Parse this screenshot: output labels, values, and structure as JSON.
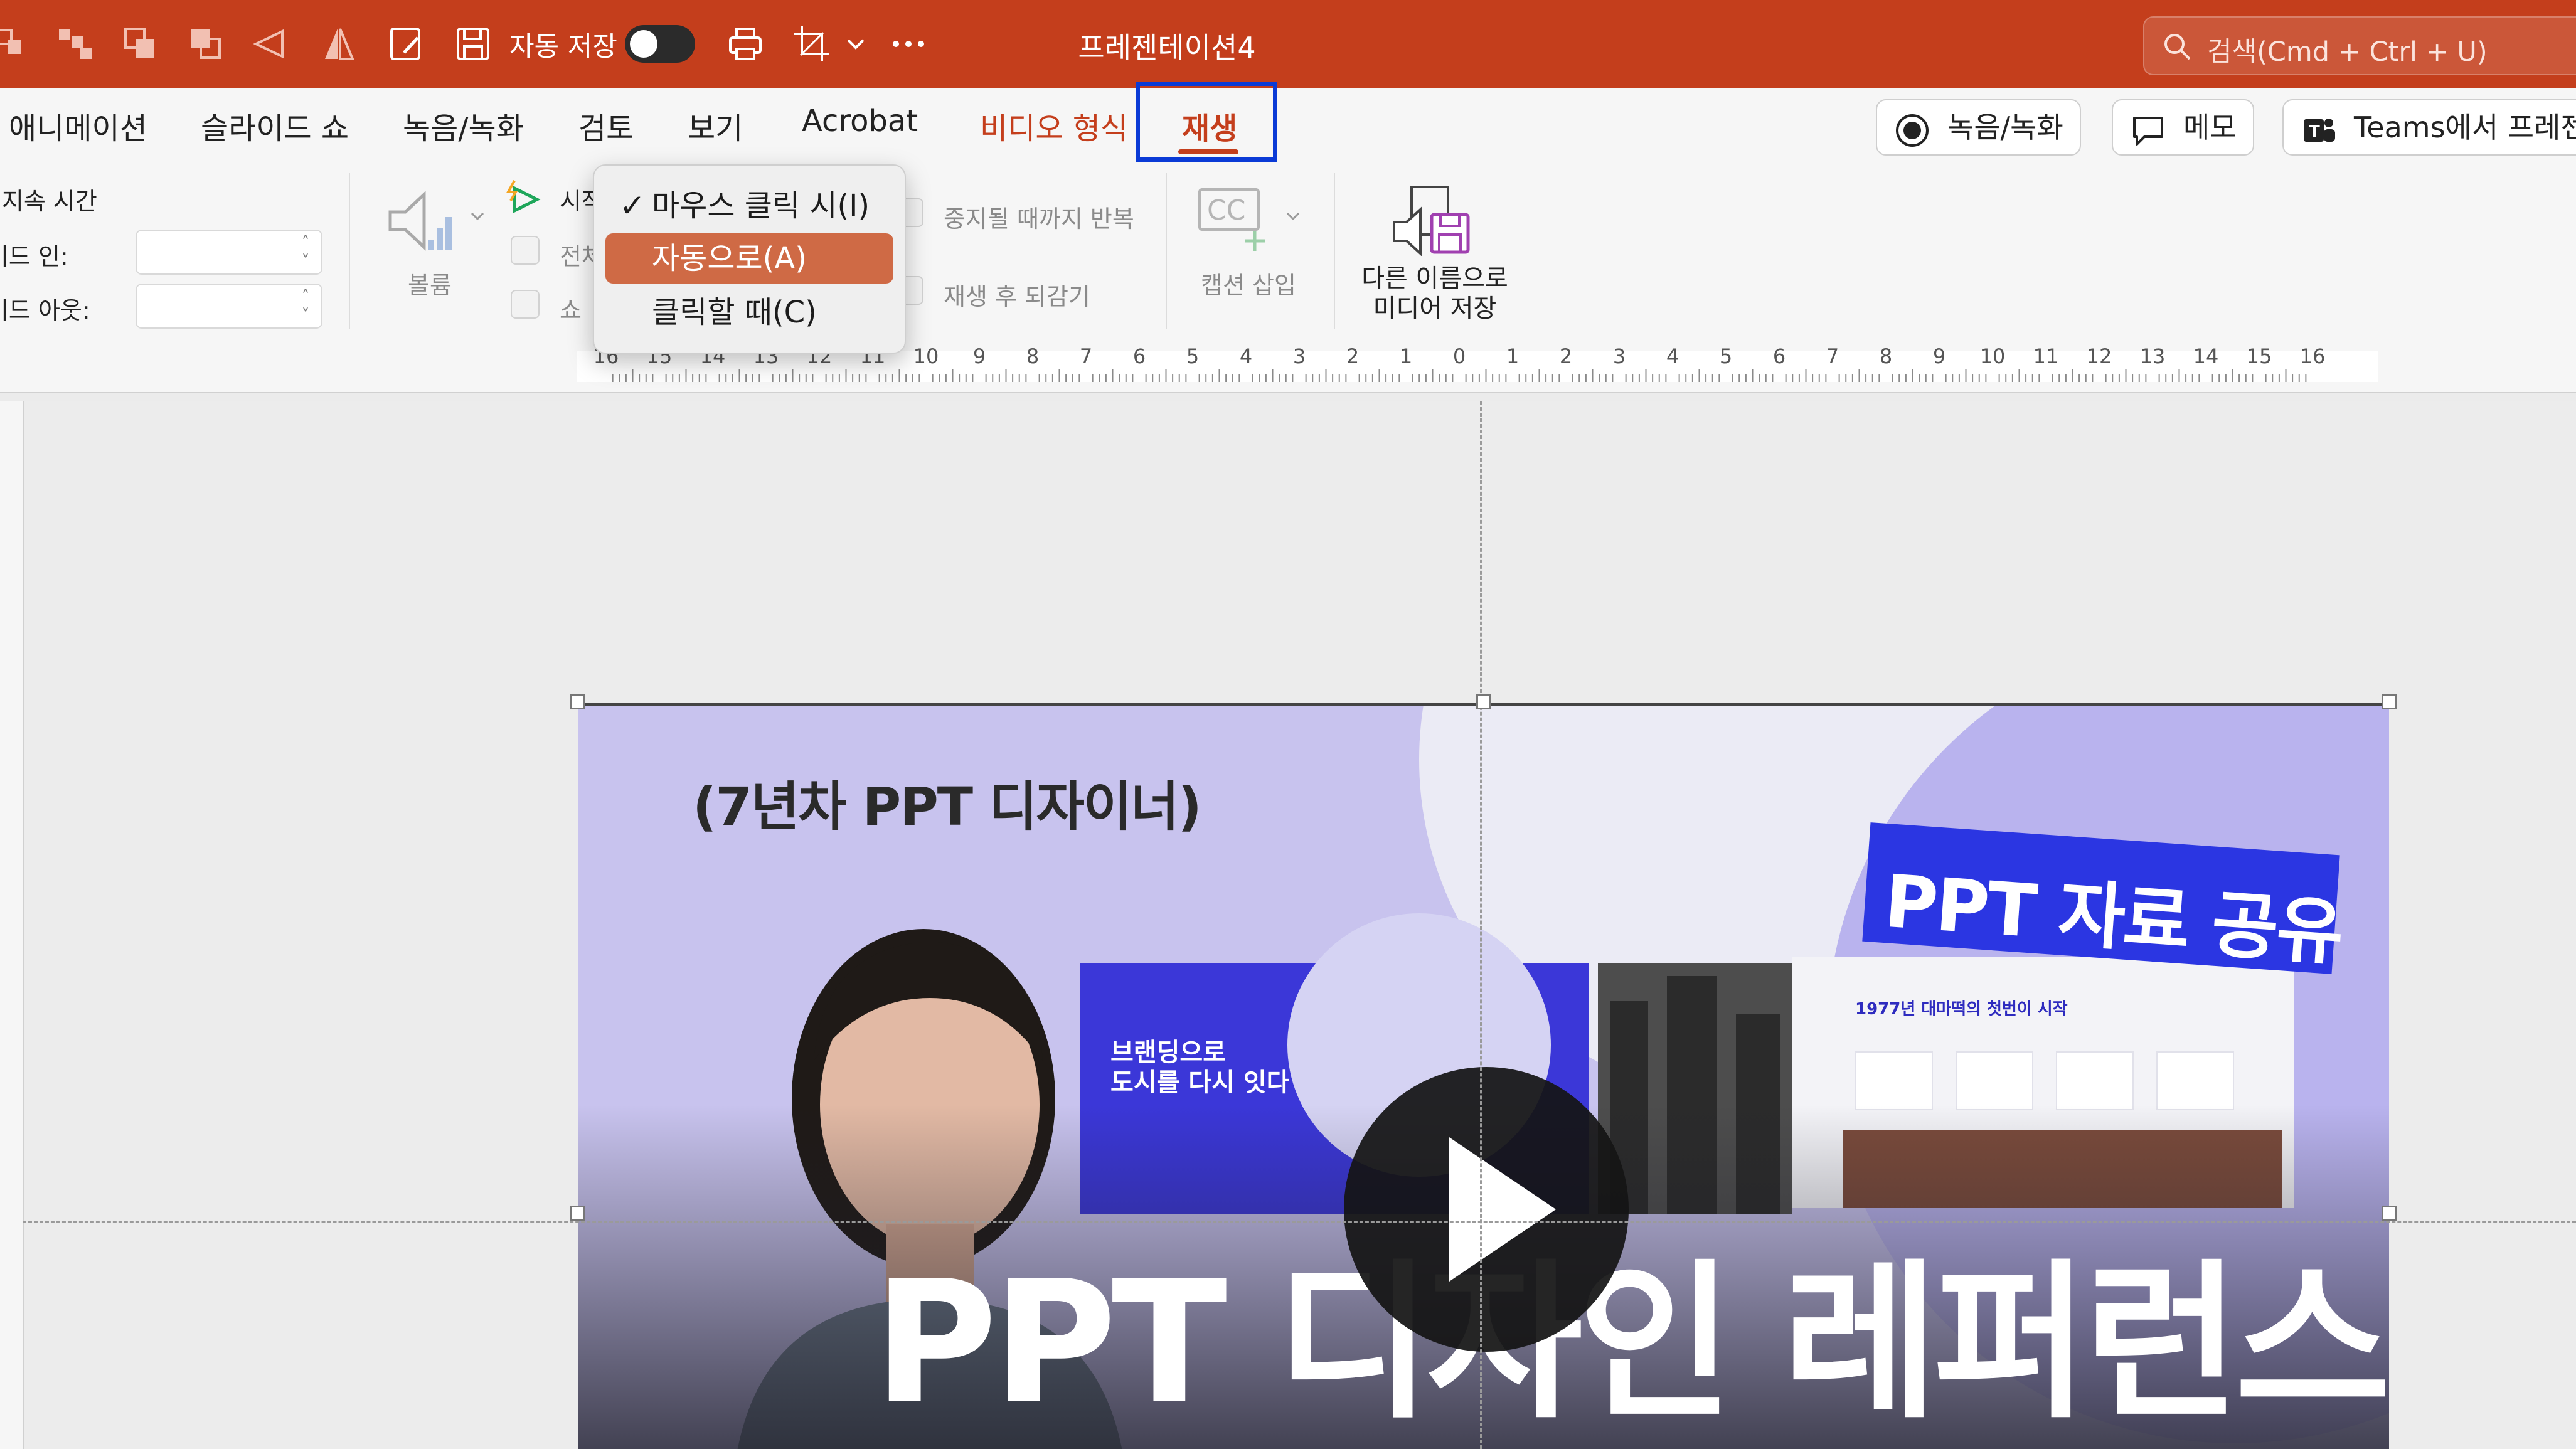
{
  "titlebar": {
    "autosave_label": "자동 저장",
    "doc_title": "프레젠테이션4",
    "search_placeholder": "검색(Cmd + Ctrl + U)"
  },
  "tabs": {
    "animation": "애니메이션",
    "slideshow": "슬라이드 쇼",
    "record": "녹음/녹화",
    "review": "검토",
    "view": "보기",
    "acrobat": "Acrobat",
    "video_format": "비디오 형식",
    "playback": "재생"
  },
  "ribbon_right": {
    "record_button": "녹음/녹화",
    "comments_button": "메모",
    "teams_button": "Teams에서 프레젠"
  },
  "ribbon": {
    "duration_label": "지속 시간",
    "fade_in_label": "페이드 인:",
    "fade_out_label": "페이드 아웃:",
    "volume_label": "볼륨",
    "start_label": "시작",
    "fullscreen_label": "전체",
    "hide_label": "쇼",
    "loop_label": "중지될 때까지 반복",
    "rewind_label": "재생 후 되감기",
    "captions_label": "캡션 삽입",
    "save_media_label": "다른 이름으로\n미디어 저장"
  },
  "start_dropdown": {
    "options": [
      "마우스 클릭 시(I)",
      "자동으로(A)",
      "클릭할 때(C)"
    ],
    "checked_index": 0,
    "highlighted_index": 1
  },
  "ruler": {
    "labels": [
      "16",
      "15",
      "14",
      "13",
      "12",
      "11",
      "10",
      "9",
      "8",
      "7",
      "6",
      "5",
      "4",
      "3",
      "2",
      "1",
      "0",
      "1",
      "2",
      "3",
      "4",
      "5",
      "6",
      "7",
      "8",
      "9",
      "10",
      "11",
      "12",
      "13",
      "14",
      "15",
      "16"
    ]
  },
  "video": {
    "designer_caption": "(7년차 PPT 디자이너)",
    "badge_text": "PPT 자료 공유",
    "headline": "PPT 디자인 레퍼런스",
    "thumb_text": "브랜딩으로\n도시를 다시 잇다",
    "thumb_title": "1977년 대마떡의 첫번이 시작"
  },
  "colors": {
    "brand": "#c43e1c",
    "tab_highlight": "#0a3ad6",
    "dropdown_selected": "#cf6a45"
  }
}
